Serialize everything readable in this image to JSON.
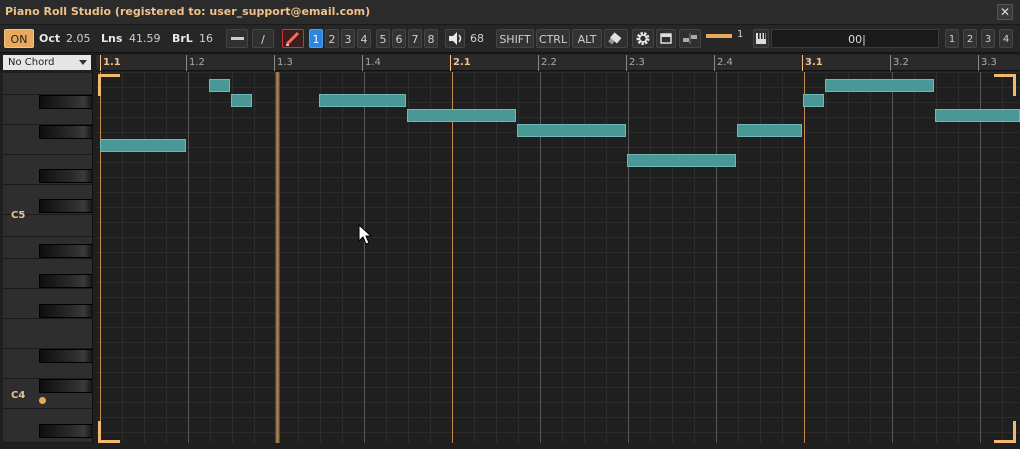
{
  "window": {
    "title": "Piano Roll Studio  (registered to: user_support@email.com)",
    "close_glyph": "✕"
  },
  "toolbar": {
    "on_label": "ON",
    "oct_label": "Oct",
    "oct_value": "2.05",
    "lns_label": "Lns",
    "lns_value": "41.59",
    "brl_label": "BrL",
    "brl_value": "16",
    "slash_label": "/",
    "numbers": [
      "1",
      "2",
      "3",
      "4",
      "5",
      "6",
      "7",
      "8"
    ],
    "selected_number": "1",
    "volume_value": "68",
    "shift_label": "SHIFT",
    "ctrl_label": "CTRL",
    "alt_label": "ALT",
    "slider_value": "1",
    "text_field_value": "00|",
    "layout_buttons": [
      "1",
      "2",
      "3",
      "4"
    ],
    "colors": {
      "accent": "#e9a95c",
      "selected": "#2a86e0",
      "note": "#4a9896"
    }
  },
  "chord_selector": {
    "value": "No Chord"
  },
  "ruler": {
    "markers": [
      "1.1",
      "1.2",
      "1.3",
      "1.4",
      "2.1",
      "2.2",
      "2.3",
      "2.4",
      "3.1",
      "3.2",
      "3.3"
    ]
  },
  "keyboard": {
    "labels": [
      "C5",
      "C4"
    ]
  },
  "notes_count_hint": "",
  "icons": [
    "close-icon",
    "pencil-icon",
    "speaker-icon",
    "eraser-icon",
    "gear-icon",
    "window-icon",
    "split-icon",
    "piano-icon",
    "mouse-cursor-icon"
  ]
}
